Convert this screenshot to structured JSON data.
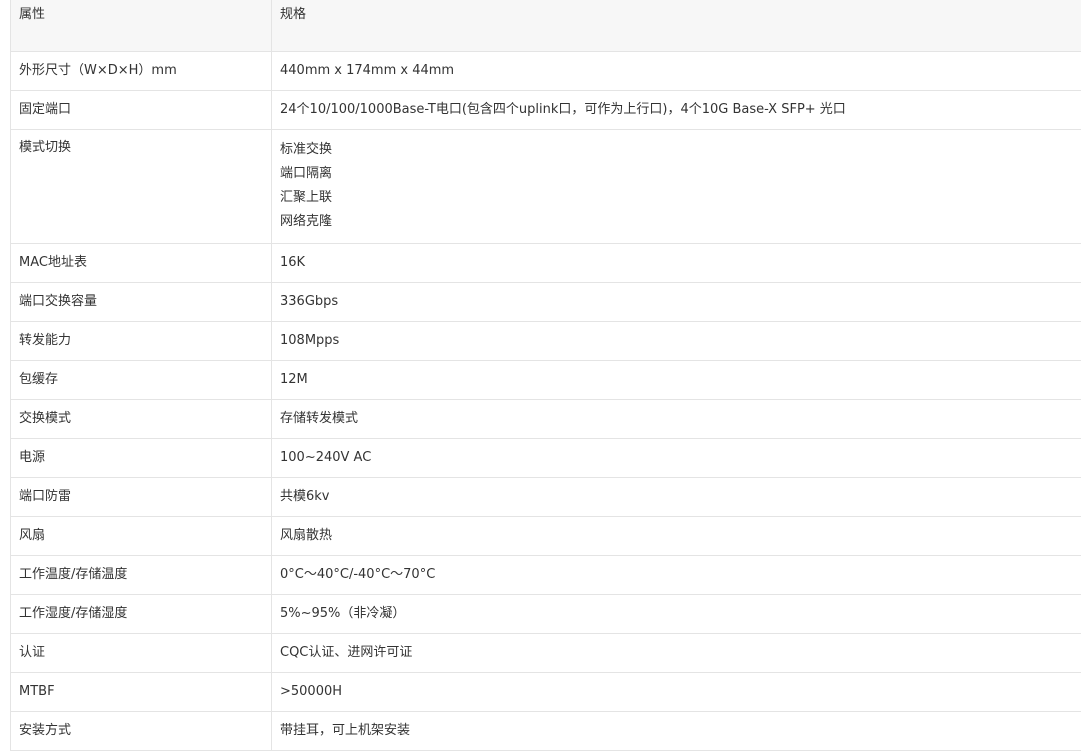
{
  "table": {
    "headers": [
      "属性",
      "规格"
    ],
    "rows": [
      {
        "key": "外形尺寸（W×D×H）mm",
        "value": "440mm x 174mm x 44mm"
      },
      {
        "key": "固定端口",
        "value": "24个10/100/1000Base-T电口(包含四个uplink口，可作为上行口)，4个10G Base-X SFP+ 光口"
      },
      {
        "key": "模式切换",
        "lines": [
          "标准交换",
          "端口隔离",
          "汇聚上联",
          "网络克隆"
        ]
      },
      {
        "key": "MAC地址表",
        "value": "16K"
      },
      {
        "key": "端口交换容量",
        "value": "336Gbps"
      },
      {
        "key": "转发能力",
        "value": "108Mpps"
      },
      {
        "key": "包缓存",
        "value": "12M"
      },
      {
        "key": "交换模式",
        "value": "存储转发模式"
      },
      {
        "key": "电源",
        "value": "100~240V AC"
      },
      {
        "key": "端口防雷",
        "value": "共模6kv"
      },
      {
        "key": "风扇",
        "value": "风扇散热"
      },
      {
        "key": "工作温度/存储温度",
        "value": "0°C～40°C/-40°C～70°C"
      },
      {
        "key": "工作湿度/存储湿度",
        "value": "5%~95%（非冷凝）"
      },
      {
        "key": "认证",
        "value": "CQC认证、进网许可证"
      },
      {
        "key": "MTBF",
        "value": ">50000H"
      },
      {
        "key": "安装方式",
        "value": "带挂耳，可上机架安装"
      }
    ]
  }
}
